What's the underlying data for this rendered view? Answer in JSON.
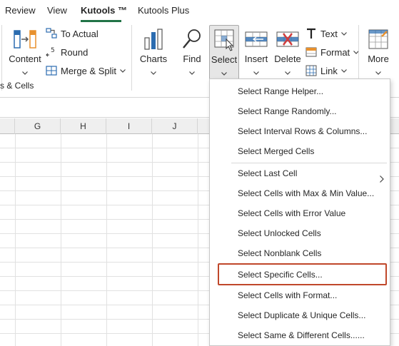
{
  "tabs": [
    {
      "label": "Review",
      "active": false
    },
    {
      "label": "View",
      "active": false
    },
    {
      "label": "Kutools ™",
      "active": true
    },
    {
      "label": "Kutools Plus",
      "active": false
    }
  ],
  "ribbon": {
    "content_label": "Content",
    "to_actual_label": "To Actual",
    "round_label": "Round",
    "merge_split_label": "Merge & Split",
    "group_label": "s & Cells",
    "charts_label": "Charts",
    "find_label": "Find",
    "select_label": "Select",
    "insert_label": "Insert",
    "delete_label": "Delete",
    "text_label": "Text",
    "format_label": "Format",
    "link_label": "Link",
    "more_label": "More"
  },
  "columns": [
    "G",
    "H",
    "I",
    "J"
  ],
  "menu": {
    "items": [
      "Select Range Helper...",
      "Select Range Randomly...",
      "Select Interval Rows & Columns...",
      "Select Merged Cells",
      "Select Last Cell",
      "Select Cells with Max & Min Value...",
      "Select Cells with Error Value",
      "Select Unlocked Cells",
      "Select Nonblank Cells",
      "Select Specific Cells...",
      "Select Cells with Format...",
      "Select Duplicate & Unique Cells...",
      "Select Same & Different Cells......"
    ],
    "highlighted_item": "Select Specific Cells..."
  },
  "colors": {
    "accent": "#217346",
    "highlight_border": "#c0472a",
    "icon_blue": "#2b6cb0",
    "icon_orange": "#e8912d",
    "icon_red": "#d23b3b"
  }
}
